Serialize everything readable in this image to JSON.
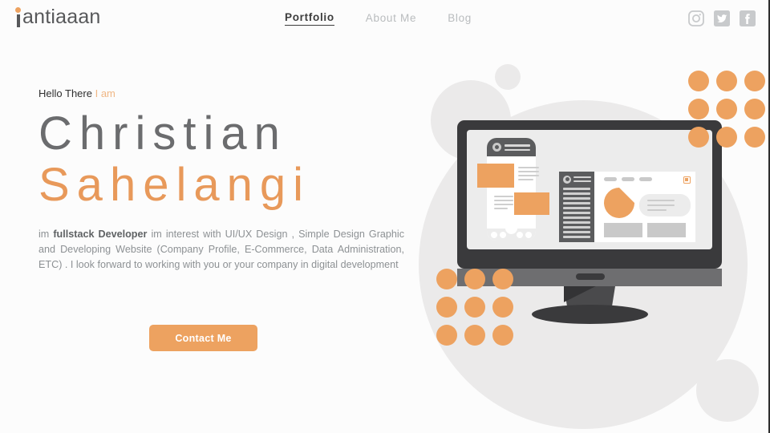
{
  "header": {
    "logo": {
      "prefix_letter": "i",
      "text": "antiaaan",
      "accent_color": "#eda260"
    },
    "nav": [
      {
        "label": "Portfolio",
        "active": true
      },
      {
        "label": "About Me",
        "active": false
      },
      {
        "label": "Blog",
        "active": false
      }
    ],
    "social": [
      {
        "name": "instagram-icon",
        "label": "Instagram"
      },
      {
        "name": "twitter-icon",
        "label": "Twitter"
      },
      {
        "name": "facebook-icon",
        "label": "Facebook"
      }
    ]
  },
  "hero": {
    "greeting_plain": "Hello There",
    "greeting_accent": "I am",
    "name_first": "Christian",
    "name_last": "Sahelangi",
    "bio_lead": "im ",
    "bio_bold": "fullstack Developer",
    "bio_rest": " im interest with UI/UX Design , Simple Design Graphic and Developing Website (Company Profile, E-Commerce, Data Administration, ETC) . I look forward to working with you or your company in digital development",
    "cta_label": "Contact Me"
  },
  "colors": {
    "accent_orange": "#eda260",
    "accent_orange_light": "#f0b785",
    "name_gray": "#6b6c6e",
    "body_gray": "#8d9194",
    "bg_circle_gray": "#ebeaea",
    "monitor_dark": "#3a3a3c",
    "monitor_chin": "#6e6e70",
    "page_bg": "#fcfcfc"
  },
  "illustration": {
    "name": "desktop-monitor-with-ui-mockups",
    "background_circles": [
      {
        "name": "bg-circle-large"
      },
      {
        "name": "bg-circle-medium"
      },
      {
        "name": "bg-circle-small"
      },
      {
        "name": "bg-circle-bottom-right"
      }
    ],
    "dot_grids": [
      {
        "name": "dot-grid-top-right",
        "rows": 3,
        "cols": 3,
        "count": 9
      },
      {
        "name": "dot-grid-bottom-left",
        "rows": 3,
        "cols": 3,
        "count": 9
      }
    ],
    "monitor": {
      "phone_mockup": {
        "name": "mobile-app-mockup",
        "orange_blocks": 2,
        "footer_circles": 4
      },
      "dashboard_mockup": {
        "name": "dashboard-ui-mockup",
        "sidebar_rows": 11,
        "nav_pills": 3,
        "chart": {
          "type": "pie",
          "name": "pie-chart",
          "slices": [
            75,
            25
          ]
        },
        "content_boxes": 2
      }
    }
  }
}
